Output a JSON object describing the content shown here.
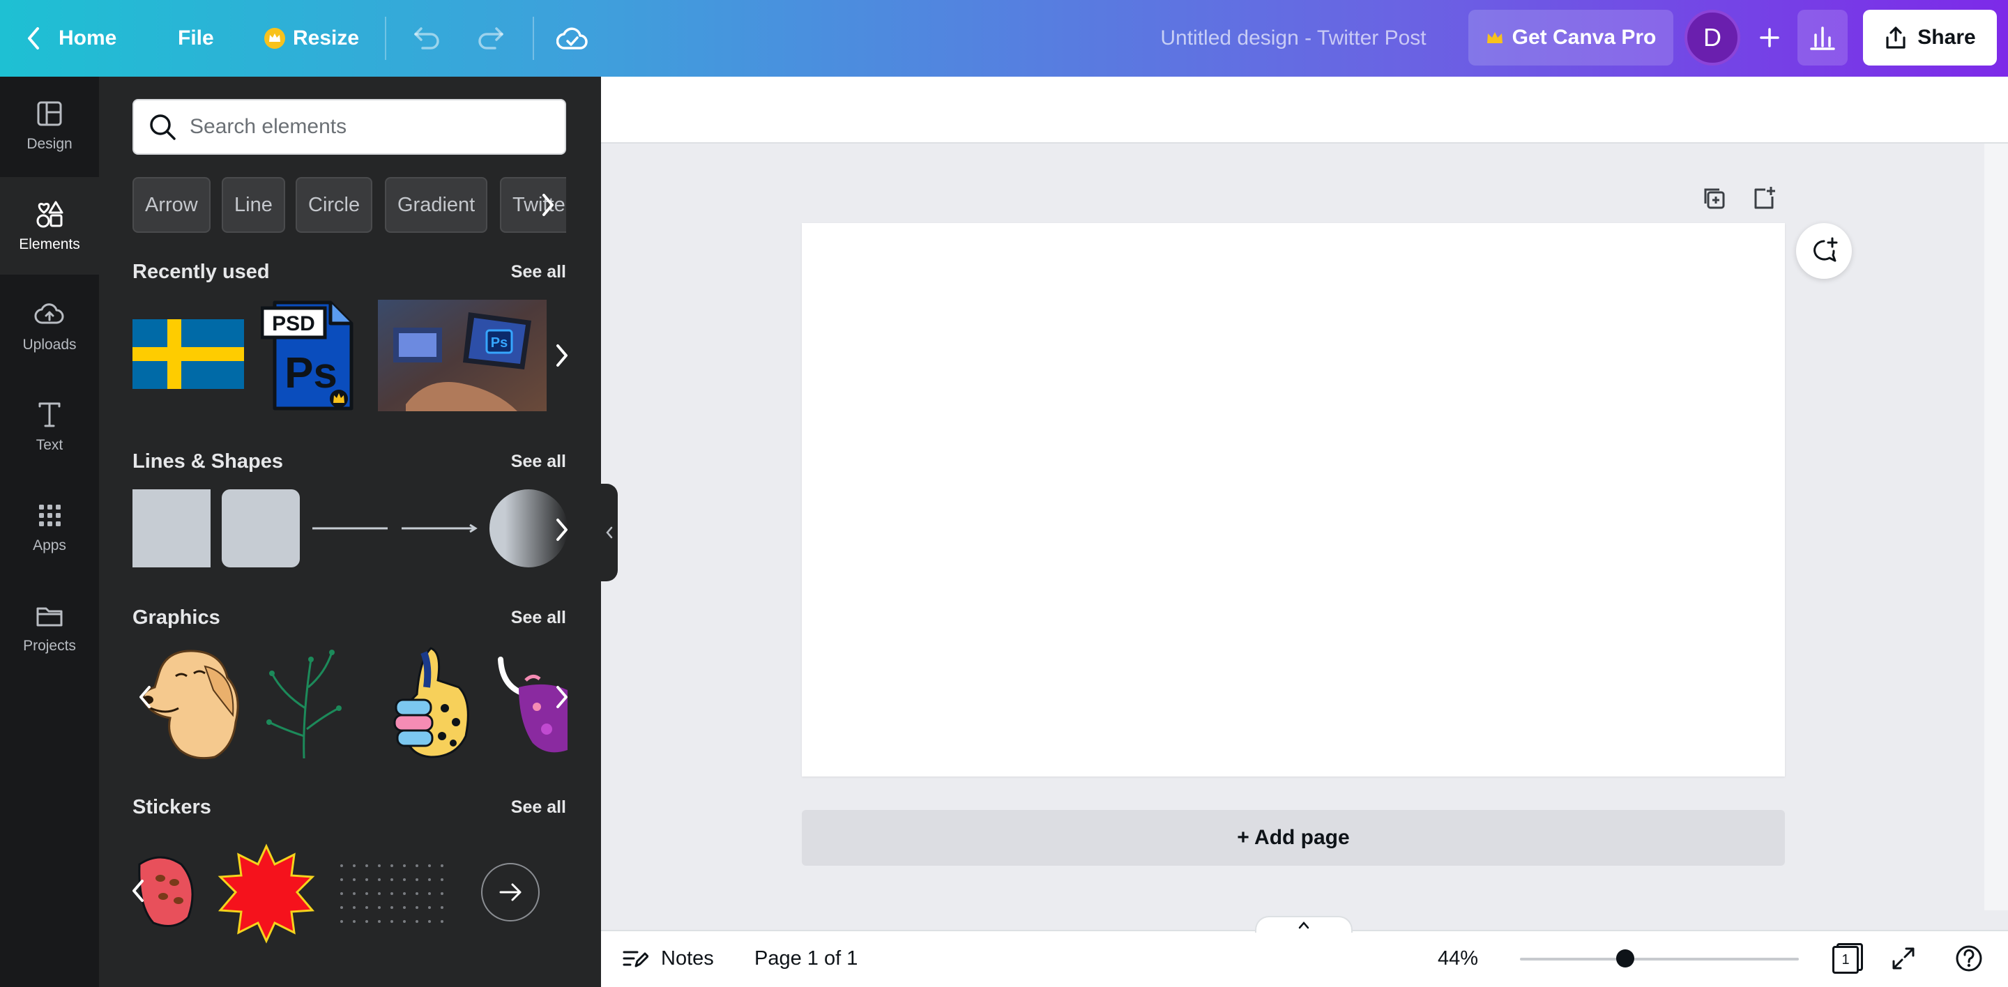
{
  "topbar": {
    "home_label": "Home",
    "file_label": "File",
    "resize_label": "Resize",
    "title": "Untitled design - Twitter Post",
    "pro_label": "Get Canva Pro",
    "avatar_initial": "D",
    "share_label": "Share"
  },
  "rail": {
    "items": [
      {
        "label": "Design",
        "icon": "layout-icon"
      },
      {
        "label": "Elements",
        "icon": "shapes-icon"
      },
      {
        "label": "Uploads",
        "icon": "cloud-upload-icon"
      },
      {
        "label": "Text",
        "icon": "text-icon"
      },
      {
        "label": "Apps",
        "icon": "grid-icon"
      },
      {
        "label": "Projects",
        "icon": "folder-icon"
      }
    ],
    "active": "Elements"
  },
  "panel": {
    "search_placeholder": "Search elements",
    "chips": [
      "Arrow",
      "Line",
      "Circle",
      "Gradient",
      "Twitter"
    ],
    "sections": {
      "recent": {
        "title": "Recently used",
        "see_all": "See all"
      },
      "shapes": {
        "title": "Lines & Shapes",
        "see_all": "See all"
      },
      "graphics": {
        "title": "Graphics",
        "see_all": "See all"
      },
      "stickers": {
        "title": "Stickers",
        "see_all": "See all"
      }
    },
    "psd_label": "PSD",
    "ps_label": "Ps"
  },
  "canvas": {
    "add_page_label": "+ Add page"
  },
  "bottombar": {
    "notes_label": "Notes",
    "page_indicator": "Page 1 of 1",
    "zoom": "44%",
    "zoom_level": 0.44,
    "page_count": "1"
  },
  "colors": {
    "gradient_start": "#1ec0d3",
    "gradient_end": "#7d2ae8",
    "panel_bg": "#252627",
    "rail_bg": "#18191b",
    "canvas_bg": "#ebecf0"
  }
}
